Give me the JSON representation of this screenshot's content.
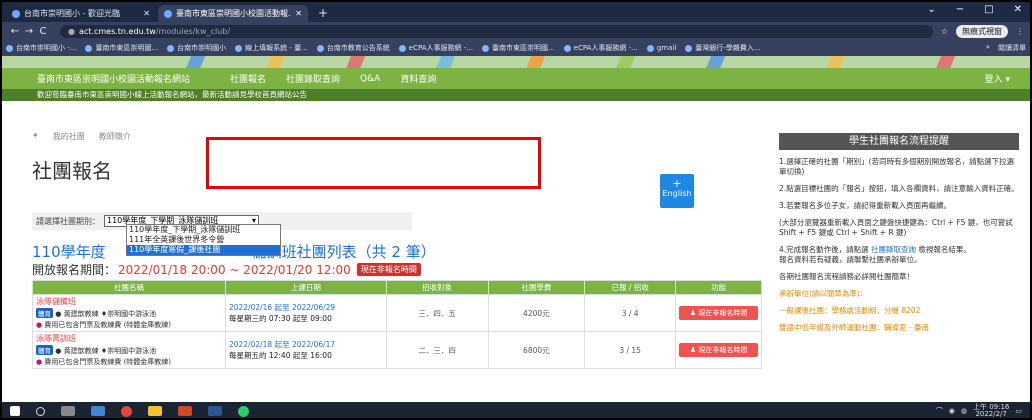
{
  "browser": {
    "tabs": [
      {
        "label": "台南市崇明國小 - 歡迎光臨",
        "active": false
      },
      {
        "label": "臺南市東區崇明國小校園活動報...",
        "active": true
      }
    ],
    "new_tab_glyph": "+",
    "window_controls": [
      "⌄",
      "−",
      "□",
      "✕"
    ],
    "url_host": "act.cmes.tn.edu.tw",
    "url_path": "/modules/kw_club/",
    "star_glyph": "☆",
    "incognito_label": "無痕式視窗",
    "menu_glyph": "⋮",
    "nav": {
      "back": "←",
      "forward": "→",
      "reload": "C"
    },
    "bookmarks": [
      "台南市崇明國小 -...",
      "臺南市東區崇明國...",
      "台南市崇明國小",
      "線上填報系統 - 臺...",
      "台南市教育公告系統",
      "eCPA人事服務網 -...",
      "臺南市東區崇明國...",
      "eCPA人事服務網 -...",
      "gmail",
      "臺灣銀行-學雜費入..."
    ],
    "bookmarks_more": "»",
    "reading_list": "閱讀清單"
  },
  "site": {
    "name": "臺南市東區崇明國小校園活動報名網站",
    "nav_links": [
      "社團報名",
      "社團錄取查詢",
      "Q&A",
      "資料查詢"
    ],
    "login": "登入 ▾",
    "announcement": "歡迎蒞臨臺南市東區崇明國小線上活動報名網站，最新活動請見學校首頁網站公告"
  },
  "breadcrumb": {
    "home_glyph": "✦",
    "items": [
      "我的社團",
      "教師簡介"
    ]
  },
  "page_title": "社團報名",
  "english_button": {
    "icon": "+",
    "label": "English"
  },
  "term_select": {
    "label": "請選擇社團期別：",
    "value": "110學年度_下學期_泳隊儲訓班",
    "arrow": "▾",
    "options": [
      "110學年度_下學期_泳隊儲訓班",
      "111年全英課後世界冬令營",
      "110學年度寒假_課後社團"
    ],
    "highlighted_index": 2
  },
  "list_heading": {
    "prefix": "110學年度",
    "suffix": "儲訓班社團列表（共 2 筆）"
  },
  "period": {
    "label": "開放報名期間：",
    "value": "2022/01/18 20:00 ~ 2022/01/20 12:00",
    "badge": "現在非報名時間"
  },
  "table": {
    "headers": [
      "社團名稱",
      "上課日期",
      "招收對象",
      "社團學費",
      "已報 / 招收",
      "功能"
    ],
    "rows": [
      {
        "name": "泳隊儲備班",
        "tag": "體育",
        "teacher": "黃建歆教練",
        "place": "崇明國中游泳池",
        "fee_note": "費用已包含門票及教練費 (特體金庫教練)",
        "date_range": "2022/02/16 起至 2022/06/29",
        "schedule": "每星期三的 07:30 起至 09:00",
        "target": "三．四．五",
        "fee": "4200元",
        "count": "3 / 4",
        "action": "現在非報名時間"
      },
      {
        "name": "泳隊菁訓班",
        "tag": "體育",
        "teacher": "黃建歆教練",
        "place": "崇明國中游泳池",
        "fee_note": "費用已包含門票及教練費 (特體金庫教練)",
        "date_range": "2022/02/18 起至 2022/06/17",
        "schedule": "每星期五的 12:40 起至 16:00",
        "target": "二．三．四",
        "fee": "6800元",
        "count": "3 / 15",
        "action": "現在非報名時間"
      }
    ]
  },
  "sidebar": {
    "title": "學生社團報名流程提醒",
    "paragraphs": [
      "1.選擇正確的社團「期別」(若同時有多個期別開放報名，請點選下拉選單切換)",
      "2.點選目標社團的「報名」按鈕，填入各欄資料，請注意輸入資料正確。",
      "3.若要報名多位子女，請記得重新載入頁面再繼續。",
      "(大部分瀏覽器重新載入頁面之鍵盤快捷鍵為：Ctrl + F5 鍵，也可嘗試 Shift + F5 鍵或 Ctrl + Shift + R 鍵)"
    ],
    "step4_prefix": "4.完成報名動作後，請點選",
    "step4_link": "社團錄取查詢",
    "step4_suffix": "檢視報名結果。",
    "contact": "報名資料若有疑義，請聯繫社團承辦單位。",
    "note": "各期社團報名流程請務必詳閱社團簡章！",
    "contacts_head": "承辦單位(請以簡章為準)：",
    "contact_line": "一般課後社團：學務處活動組，分機 8202",
    "contact_line2": "雙語中低年級及外師運動社團：輔導室 - 臺南"
  },
  "taskbar": {
    "time": "上午 09:16",
    "date": "2022/2/7"
  }
}
